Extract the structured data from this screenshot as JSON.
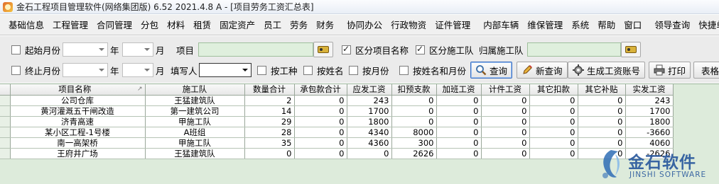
{
  "window": {
    "title": "金石工程项目管理软件(网络集团版) 6.52  2021.4.8 A - [项目劳务工资汇总表]"
  },
  "menu": [
    "基础信息",
    "工程管理",
    "合同管理",
    "分包",
    "材料",
    "租赁",
    "固定资产",
    "员工",
    "劳务",
    "财务",
    "|",
    "协同办公",
    "行政物资",
    "证件管理",
    "|",
    "内部车辆",
    "维保管理",
    "系统",
    "帮助",
    "窗口",
    "|",
    "领导查询",
    "快捷单据"
  ],
  "filter": {
    "start_month_label": "起始月份",
    "end_month_label": "终止月份",
    "year_unit": "年",
    "month_unit": "月",
    "project_label": "项目",
    "distinguish_project_label": "区分项目名称",
    "distinguish_team_label": "区分施工队",
    "team_label": "归属施工队",
    "filler_label": "填写人",
    "by_type_label": "按工种",
    "by_name_label": "按姓名",
    "by_month_label": "按月份",
    "by_name_month_label": "按姓名和月份",
    "start_checked": false,
    "end_checked": false,
    "distinguish_project_checked": true,
    "distinguish_team_checked": true,
    "by_type_checked": false,
    "by_name_checked": false,
    "by_month_checked": false,
    "by_name_month_checked": false
  },
  "buttons": {
    "query": "查询",
    "new_query": "新查询",
    "gen_payroll": "生成工资账号",
    "print": "打印",
    "table": "表格"
  },
  "table": {
    "columns": [
      "项目名称",
      "施工队",
      "数量合计",
      "承包款合计",
      "应发工资",
      "扣预支款",
      "加班工资",
      "计件工资",
      "其它扣款",
      "其它补贴",
      "实发工资"
    ],
    "rows": [
      [
        "公司仓库",
        "王猛建筑队",
        "2",
        "0",
        "243",
        "0",
        "0",
        "0",
        "0",
        "0",
        "243"
      ],
      [
        "黄河灌溉五干闸改造",
        "第一建筑公司",
        "14",
        "0",
        "1700",
        "0",
        "0",
        "0",
        "0",
        "0",
        "1700"
      ],
      [
        "济青高速",
        "甲施工队",
        "29",
        "0",
        "1800",
        "0",
        "0",
        "0",
        "0",
        "0",
        "1800"
      ],
      [
        "某小区工程-1号楼",
        "A班组",
        "28",
        "0",
        "4340",
        "8000",
        "0",
        "0",
        "0",
        "0",
        "-3660"
      ],
      [
        "南一高架桥",
        "甲施工队",
        "35",
        "0",
        "4360",
        "300",
        "0",
        "0",
        "0",
        "0",
        "4060"
      ],
      [
        "王府井广场",
        "王猛建筑队",
        "0",
        "0",
        "0",
        "2626",
        "0",
        "0",
        "0",
        "0",
        "-2626"
      ]
    ]
  },
  "brand": {
    "cn": "金石软件",
    "en": "JINSHI SOFTWARE"
  },
  "colors": {
    "grid_bg": "#ddebdb",
    "filter_bg": "#ebebeb",
    "green_input": "#dfefdd",
    "brand_blue": "#2b5a9e"
  }
}
